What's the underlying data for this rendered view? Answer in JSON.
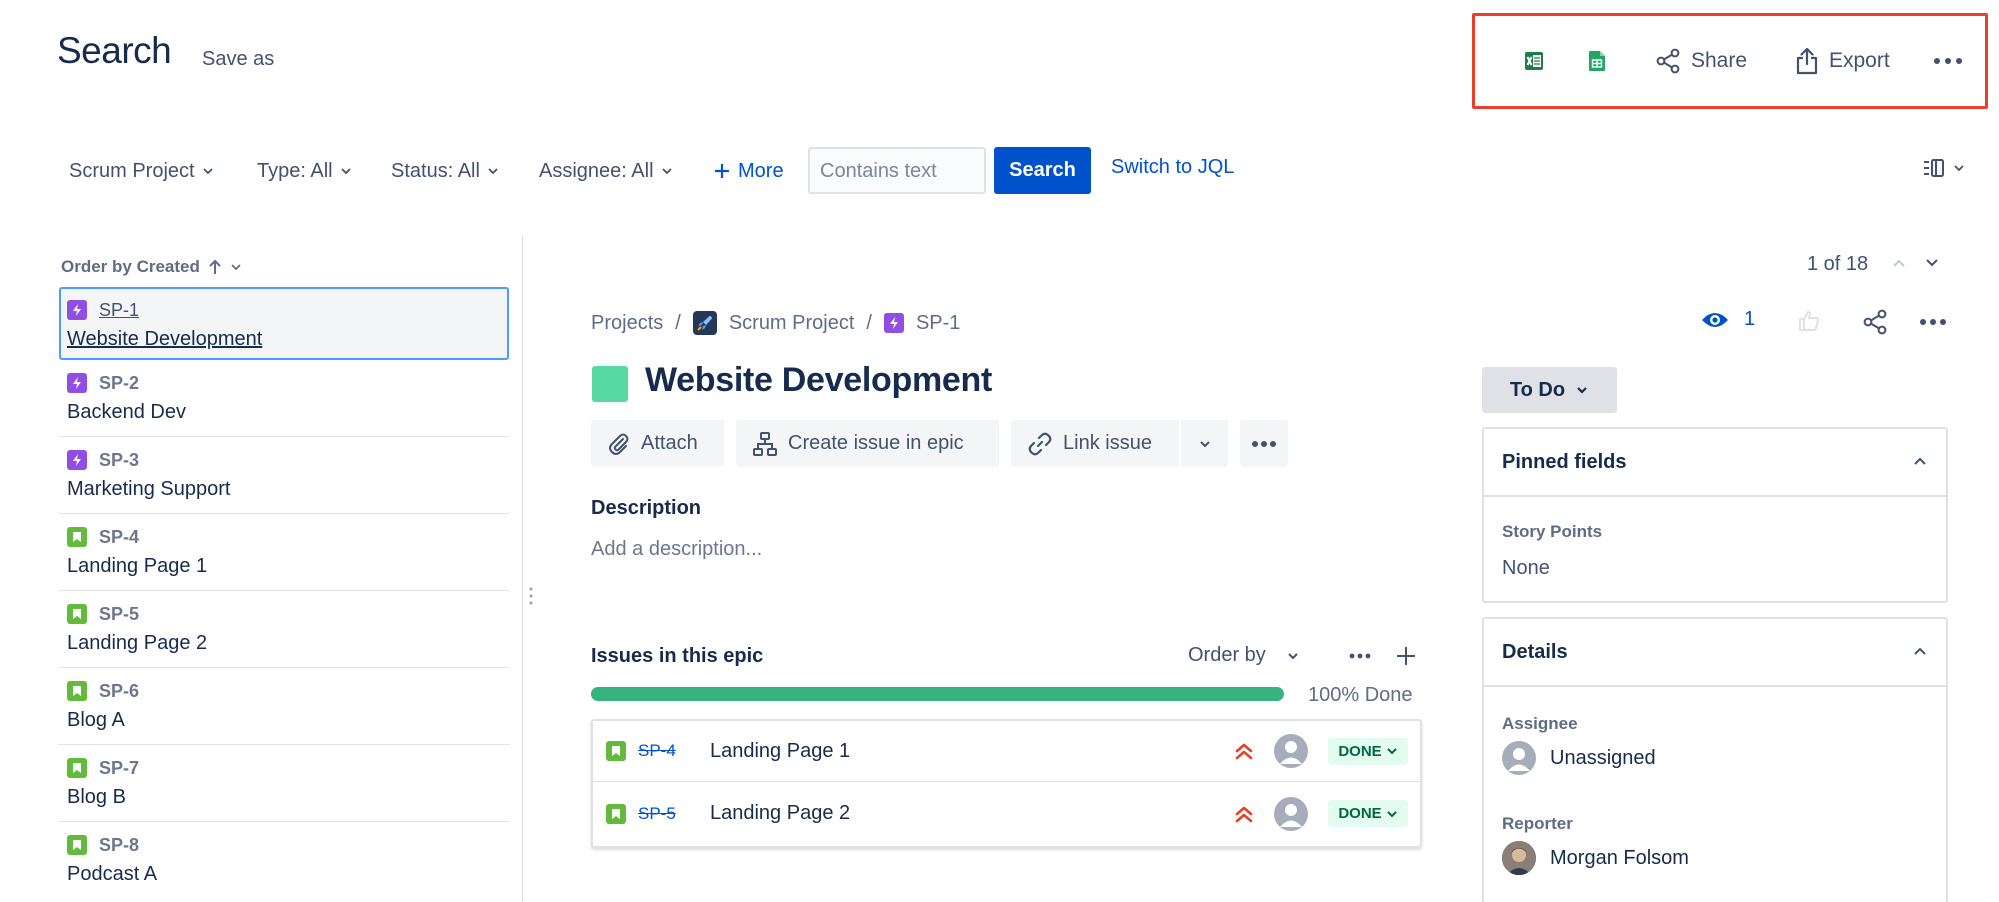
{
  "header": {
    "title": "Search",
    "save_as": "Save as",
    "share_label": "Share",
    "export_label": "Export"
  },
  "filters": {
    "project": "Scrum Project",
    "type": "Type: All",
    "status": "Status: All",
    "assignee": "Assignee: All",
    "more": "More",
    "contains_placeholder": "Contains text",
    "search_button": "Search",
    "switch_jql": "Switch to JQL"
  },
  "list": {
    "order_by": "Order by Created",
    "items": [
      {
        "key": "SP-1",
        "title": "Website Development",
        "type": "epic"
      },
      {
        "key": "SP-2",
        "title": "Backend Dev",
        "type": "epic"
      },
      {
        "key": "SP-3",
        "title": "Marketing Support",
        "type": "epic"
      },
      {
        "key": "SP-4",
        "title": "Landing Page 1",
        "type": "story"
      },
      {
        "key": "SP-5",
        "title": "Landing Page 2",
        "type": "story"
      },
      {
        "key": "SP-6",
        "title": "Blog A",
        "type": "story"
      },
      {
        "key": "SP-7",
        "title": "Blog B",
        "type": "story"
      },
      {
        "key": "SP-8",
        "title": "Podcast A",
        "type": "story"
      }
    ]
  },
  "pager": {
    "text": "1 of 18"
  },
  "issue": {
    "breadcrumb": {
      "projects": "Projects",
      "project": "Scrum Project",
      "key": "SP-1"
    },
    "watchers": "1",
    "title": "Website Development",
    "actions": {
      "attach": "Attach",
      "create_in_epic": "Create issue in epic",
      "link_issue": "Link issue"
    },
    "description_label": "Description",
    "description_placeholder": "Add a description...",
    "epic_section": {
      "title": "Issues in this epic",
      "order_by": "Order by",
      "progress": 1.0,
      "progress_text": "100% Done",
      "children": [
        {
          "key": "SP-4",
          "title": "Landing Page 1",
          "status": "DONE"
        },
        {
          "key": "SP-5",
          "title": "Landing Page 2",
          "status": "DONE"
        }
      ]
    }
  },
  "sidebar": {
    "status": "To Do",
    "pinned": {
      "title": "Pinned fields",
      "story_points_label": "Story Points",
      "story_points_value": "None"
    },
    "details": {
      "title": "Details",
      "assignee_label": "Assignee",
      "assignee_value": "Unassigned",
      "reporter_label": "Reporter",
      "reporter_value": "Morgan Folsom"
    }
  },
  "colors": {
    "primary": "#0052cc",
    "epic": "#904ee2",
    "story": "#63ba3c",
    "done_bg": "#e3fcef",
    "highlight": "#e8402b",
    "progress": "#36b37e"
  }
}
